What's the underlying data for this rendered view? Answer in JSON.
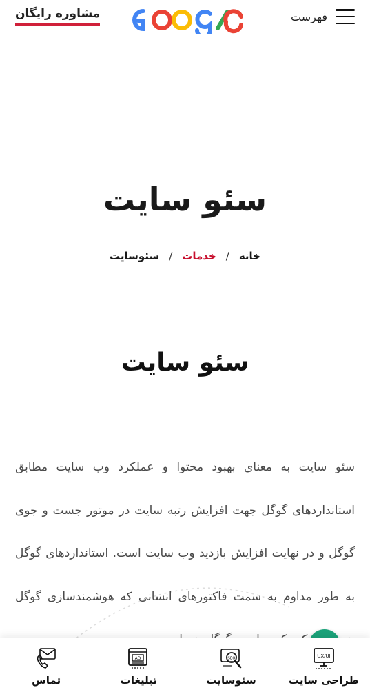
{
  "header": {
    "menu_label": "فهرست",
    "cta_label": "مشاوره رایگان",
    "logo_colors": [
      "#4285F4",
      "#EA4335",
      "#FBBC05",
      "#4285F4",
      "#34A853",
      "#EA4335"
    ]
  },
  "hero": {
    "title": "سئو سایت",
    "breadcrumb": {
      "home": "خانه",
      "separator": "/",
      "services": "خدمات",
      "current": "سئوسایت"
    }
  },
  "section": {
    "title": "سئو سایت",
    "body": "سئو سایت به معنای بهبود محتوا و عملکرد وب سایت مطابق استانداردهای گوگل جهت افزایش رتبه سایت در موتور جست و جوی گوگل و در نهایت افزایش بازدید وب سایت است. استانداردهای گوگل به طور مداوم به سمت فاکتورهای انسانی که هوشمندسازی گوگل هستند حرکت کرده است گوگل همواره"
  },
  "bottom_nav": [
    {
      "label": "طراحی سایت",
      "icon": "ux-ui-monitor-icon"
    },
    {
      "label": "سئوسایت",
      "icon": "seo-magnifier-icon"
    },
    {
      "label": "تبلیغات",
      "icon": "ads-browser-icon"
    },
    {
      "label": "تماس",
      "icon": "phone-envelope-icon"
    }
  ],
  "colors": {
    "accent": "#c8102e",
    "cta_underline": "#d0203a",
    "chat": "#1ba37a"
  }
}
